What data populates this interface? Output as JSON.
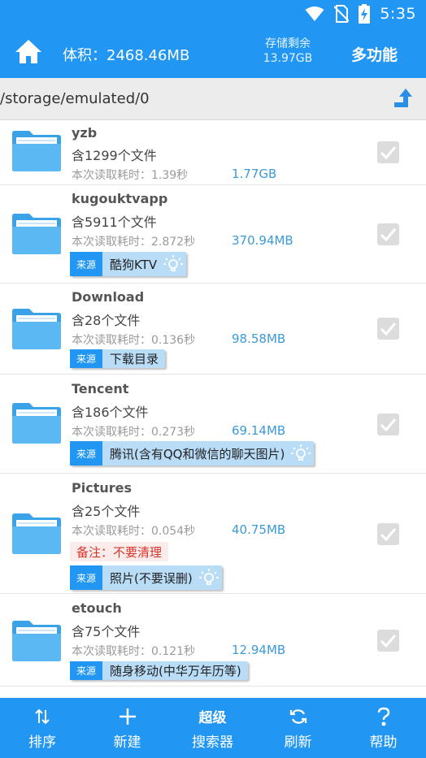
{
  "status_bar": {
    "time": "5:35",
    "icons": [
      "wifi-icon",
      "no-sim-icon",
      "battery-charging-icon"
    ]
  },
  "header": {
    "home_icon": "home-icon",
    "volume_label": "体积：2468.46MB",
    "storage_title": "存储剩余",
    "storage_value": "13.97GB",
    "multi_function": "多功能"
  },
  "path": {
    "current": "/storage/emulated/0",
    "up_icon": "folder-up-icon"
  },
  "folders": [
    {
      "name": "yzb",
      "count": "含1299个文件",
      "read_time": "本次读取耗时：1.39秒",
      "size": "1.77GB"
    },
    {
      "name": "kugouktvapp",
      "count": "含5911个文件",
      "read_time": "本次读取耗时：2.872秒",
      "size": "370.94MB",
      "source_label": "来源",
      "source": "酷狗KTV",
      "bulb": true
    },
    {
      "name": "Download",
      "count": "含28个文件",
      "read_time": "本次读取耗时：0.136秒",
      "size": "98.58MB",
      "source_label": "来源",
      "source": "下载目录",
      "bulb": false
    },
    {
      "name": "Tencent",
      "count": "含186个文件",
      "read_time": "本次读取耗时：0.273秒",
      "size": "69.14MB",
      "source_label": "来源",
      "source": "腾讯(含有QQ和微信的聊天图片)",
      "bulb": true
    },
    {
      "name": "Pictures",
      "count": "含25个文件",
      "read_time": "本次读取耗时：0.054秒",
      "size": "40.75MB",
      "note": "备注：不要清理",
      "source_label": "来源",
      "source": "照片(不要误删)",
      "bulb": true
    },
    {
      "name": "etouch",
      "count": "含75个文件",
      "read_time": "本次读取耗时：0.121秒",
      "size": "12.94MB",
      "source_label": "来源",
      "source": "随身移动(中华万年历等)",
      "bulb": false
    }
  ],
  "bottom_nav": [
    {
      "icon": "sort-icon",
      "label": "排序"
    },
    {
      "icon": "plus-icon",
      "label": "新建"
    },
    {
      "top": "超级",
      "label": "搜索器"
    },
    {
      "icon": "refresh-icon",
      "label": "刷新"
    },
    {
      "icon": "help-icon",
      "label": "帮助"
    }
  ],
  "colors": {
    "primary": "#2196f3",
    "size_text": "#3b9ad9",
    "note_text": "#d9342b",
    "tag_bg": "#b9dcf7"
  }
}
